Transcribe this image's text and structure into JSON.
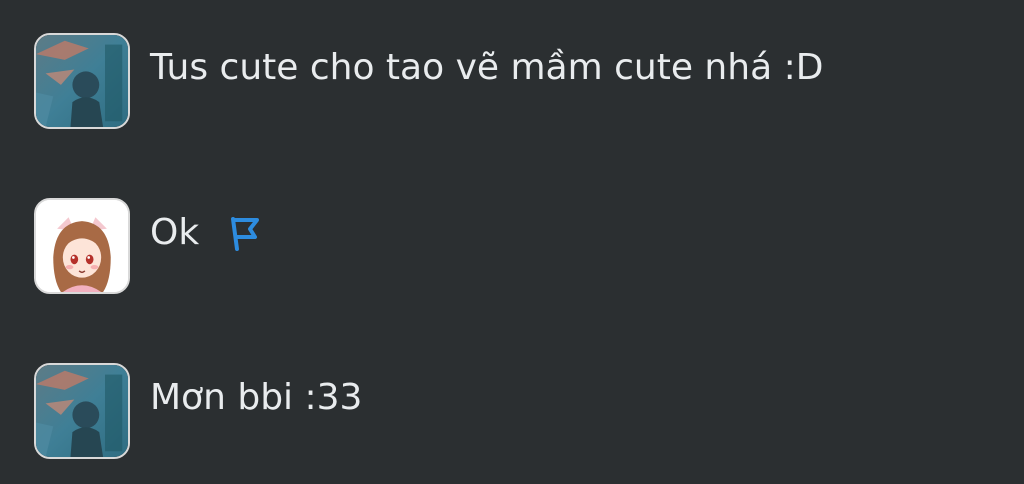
{
  "messages": [
    {
      "avatar": "avatar-photo-icon",
      "text": "Tus cute cho tao vẽ mầm cute nhá :D"
    },
    {
      "avatar": "avatar-anime-girl-icon",
      "text": "Ok",
      "action_icon": "flag-icon"
    },
    {
      "avatar": "avatar-photo-icon",
      "text": "Mơn bbi :33"
    }
  ],
  "colors": {
    "background": "#2b2f31",
    "text": "#e9ecee",
    "flag": "#2d8cdf",
    "avatar_border": "#d9d9d9"
  }
}
